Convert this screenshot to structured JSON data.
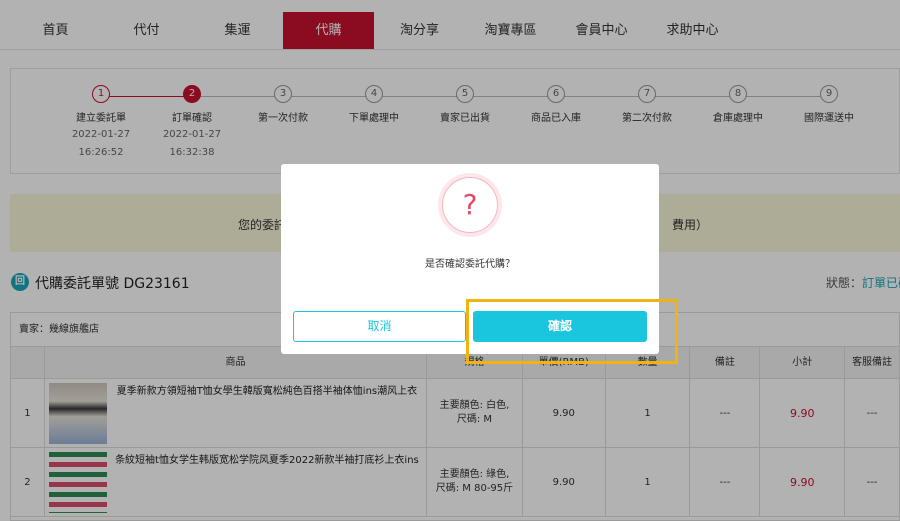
{
  "nav": {
    "items": [
      "首頁",
      "代付",
      "集運",
      "代購",
      "淘分享",
      "淘寶專區",
      "會員中心",
      "求助中心"
    ],
    "active_index": 3
  },
  "progress": {
    "steps": [
      {
        "num": "1",
        "label": "建立委託單",
        "date": "2022-01-27",
        "time": "16:26:52",
        "state": "done"
      },
      {
        "num": "2",
        "label": "訂單確認",
        "date": "2022-01-27",
        "time": "16:32:38",
        "state": "current"
      },
      {
        "num": "3",
        "label": "第一次付款",
        "state": "pending"
      },
      {
        "num": "4",
        "label": "下單處理中",
        "state": "pending"
      },
      {
        "num": "5",
        "label": "賣家已出貨",
        "state": "pending"
      },
      {
        "num": "6",
        "label": "商品已入庫",
        "state": "pending"
      },
      {
        "num": "7",
        "label": "第二次付款",
        "state": "pending"
      },
      {
        "num": "8",
        "label": "倉庫處理中",
        "state": "pending"
      },
      {
        "num": "9",
        "label": "國際運送中",
        "state": "pending"
      }
    ]
  },
  "notice": {
    "left_text": "您的委託",
    "right_text": "費用）"
  },
  "order": {
    "title": "代購委託單號 DG23161",
    "status_label": "狀態：",
    "status_value": "訂單已確"
  },
  "table": {
    "seller": "賣家：幾線旗艦店",
    "headers": [
      "",
      "商品",
      "規格",
      "單價(RMB)",
      "數量",
      "備註",
      "小計",
      "客服備註"
    ],
    "rows": [
      {
        "no": "1",
        "name": "夏季新款方領短袖T恤女學生韓版寬松純色百搭半袖体恤ins潮风上衣",
        "spec": "主要顏色: 白色, 尺碼: M",
        "price": "9.90",
        "qty": "1",
        "note": "---",
        "subtotal": "9.90",
        "service_note": "---"
      },
      {
        "no": "2",
        "name": "条紋短袖t恤女学生韩版宽松学院风夏季2022新款半袖打底衫上衣ins",
        "spec": "主要顏色: 綠色, 尺碼: M 80-95斤",
        "price": "9.90",
        "qty": "1",
        "note": "---",
        "subtotal": "9.90",
        "service_note": "---"
      }
    ]
  },
  "modal": {
    "icon": "question-icon",
    "message": "是否確認委託代購？",
    "cancel_label": "取消",
    "confirm_label": "確認"
  },
  "colors": {
    "brand_red": "#c8102e",
    "accent_cyan": "#19c6dd",
    "highlight": "#f2b30f"
  }
}
